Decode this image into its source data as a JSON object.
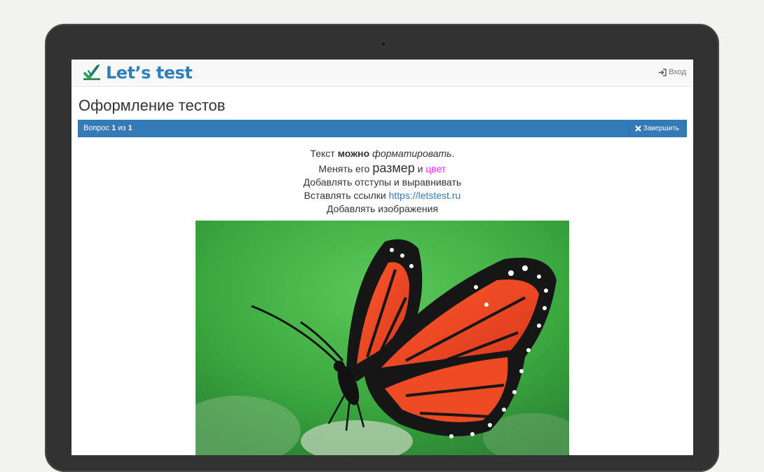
{
  "brand": {
    "name": "Let’s test"
  },
  "nav": {
    "login_label": "Вход"
  },
  "page": {
    "title": "Оформление тестов"
  },
  "question_bar": {
    "prefix": "Вопрос",
    "current": "1",
    "sep": "из",
    "total": "1",
    "finish_label": "Завершить"
  },
  "content": {
    "line1_a": "Текст",
    "line1_b": "можно",
    "line1_c": "форматировать",
    "line1_d": ".",
    "line2_a": "Менять его",
    "line2_b": "размер",
    "line2_c": "и",
    "line2_d": "цвет",
    "line3": "Добавлять отступы и выравнивать",
    "line4_a": "Вставлять ссылки",
    "line4_link": "https://letstest.ru",
    "line5": "Добавлять изображения"
  },
  "colors": {
    "primary": "#337ab7",
    "brand": "#2f7fbb",
    "accent_text": "#ff22ff"
  }
}
